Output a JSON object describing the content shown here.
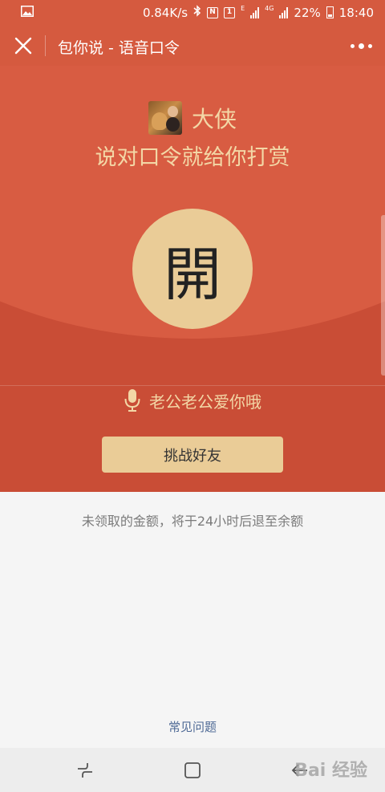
{
  "status_bar": {
    "speed": "0.84K/s",
    "nfc": "N",
    "sim_badge": "1",
    "e_label": "E",
    "network": "4G",
    "battery": "22%",
    "time": "18:40"
  },
  "header": {
    "title": "包你说 - 语音口令"
  },
  "envelope": {
    "sender_name": "大侠",
    "subtitle": "说对口令就给你打赏",
    "open_char": "開",
    "voice_phrase": "老公老公爱你哦",
    "challenge_label": "挑战好友"
  },
  "footer": {
    "notice": "未领取的金额，将于24小时后退至余额",
    "faq_link": "常见问题"
  },
  "watermark": "Bai 经验",
  "colors": {
    "header_red": "#d55a3f",
    "panel_red": "#c94d36",
    "gold": "#eacc97",
    "gold_text": "#f3d7a6",
    "link_blue": "#4f6a96"
  }
}
